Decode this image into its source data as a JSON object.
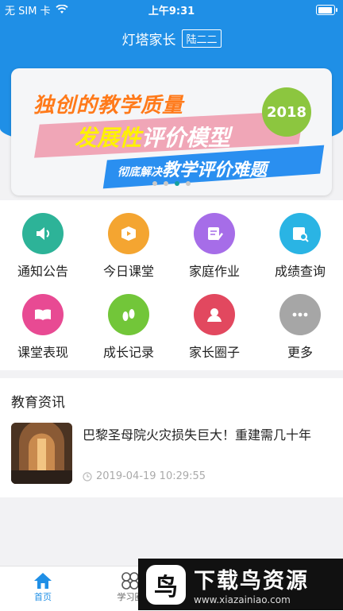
{
  "status_bar": {
    "carrier": "无 SIM 卡",
    "time": "上午9:31"
  },
  "header": {
    "title": "灯塔家长",
    "school_tag": "陆二二"
  },
  "banner": {
    "line1": "独创的教学质量",
    "line2_a": "发展性",
    "line2_b": "评价模型",
    "line3_a": "彻底解决",
    "line3_b": "教学评价难题",
    "year": "2018",
    "dots_total": 4,
    "dots_active": 3
  },
  "menu": {
    "items": [
      {
        "label": "通知公告",
        "icon": "speaker-icon",
        "color": "#2db398"
      },
      {
        "label": "今日课堂",
        "icon": "play-box-icon",
        "color": "#f4a531"
      },
      {
        "label": "家庭作业",
        "icon": "pencil-note-icon",
        "color": "#a66de8"
      },
      {
        "label": "成绩查询",
        "icon": "search-report-icon",
        "color": "#2ab4e4"
      },
      {
        "label": "课堂表现",
        "icon": "book-icon",
        "color": "#e84a93"
      },
      {
        "label": "成长记录",
        "icon": "footprint-icon",
        "color": "#72c639"
      },
      {
        "label": "家长圈子",
        "icon": "people-icon",
        "color": "#e2485f"
      },
      {
        "label": "更多",
        "icon": "more-icon",
        "color": "#a6a6a6"
      }
    ]
  },
  "news": {
    "section_title": "教育资讯",
    "items": [
      {
        "headline": "巴黎圣母院火灾损失巨大！重建需几十年",
        "time": "2019-04-19 10:29:55"
      }
    ]
  },
  "tabbar": {
    "tabs": [
      {
        "label": "首页",
        "active": true
      },
      {
        "label": "学习圈",
        "active": false
      }
    ]
  },
  "watermark": {
    "name": "下载鸟资源",
    "url": "www.xiazainiao.com"
  },
  "colors": {
    "primary": "#1f8fe6",
    "active_dot": "#14a0a0"
  }
}
